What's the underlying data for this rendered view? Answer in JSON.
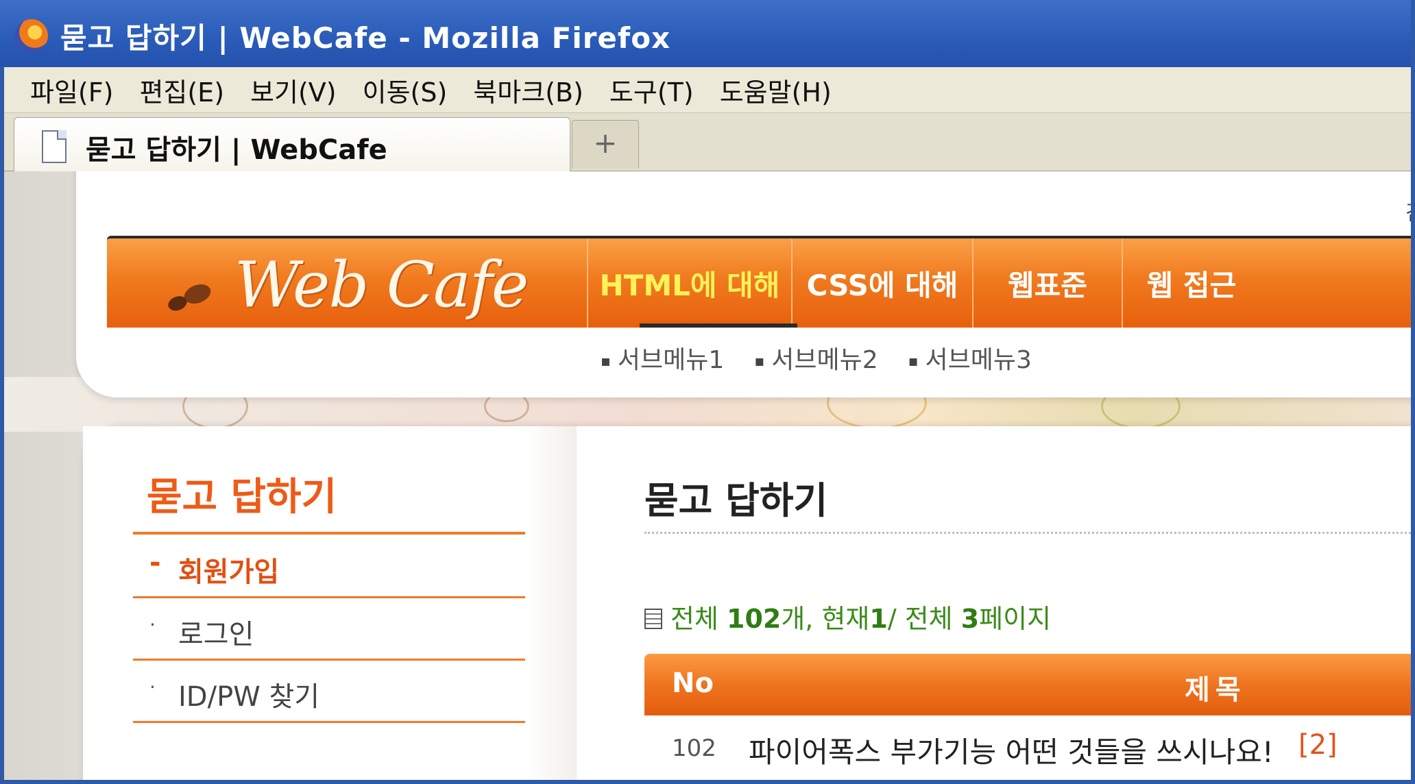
{
  "window": {
    "title": "묻고 답하기 | WebCafe - Mozilla Firefox"
  },
  "menubar": {
    "items": [
      "파일(F)",
      "편집(E)",
      "보기(V)",
      "이동(S)",
      "북마크(B)",
      "도구(T)",
      "도움말(H)"
    ]
  },
  "tabs": {
    "active_label": "묻고 답하기 | WebCafe",
    "new_tab_label": "+"
  },
  "site": {
    "logo_text": "Web Cafe",
    "search_hint": "검",
    "gnb": [
      "HTML에 대해",
      "CSS에 대해",
      "웹표준",
      "웹 접근"
    ],
    "active_gnb_color": "#fff35a",
    "submenu": [
      "서브메뉴1",
      "서브메뉴2",
      "서브메뉴3"
    ]
  },
  "sidebar": {
    "title": "묻고 답하기",
    "items": [
      {
        "bullet": "-",
        "label": "회원가입",
        "active": true
      },
      {
        "bullet": "·",
        "label": "로그인",
        "active": false
      },
      {
        "bullet": "·",
        "label": "ID/PW 찾기",
        "active": false
      }
    ]
  },
  "main": {
    "title": "묻고 답하기",
    "summary": {
      "prefix": "전체 ",
      "total": "102",
      "middle": "개, 현재",
      "current": "1",
      "sep": "/ 전체 ",
      "pages": "3",
      "suffix": "페이지"
    },
    "columns": {
      "no": "No",
      "title": "제목"
    },
    "rows": [
      {
        "no": "102",
        "title": "파이어폭스 부가기능 어떤 것들을 쓰시나요!",
        "comments": "[2]"
      }
    ]
  },
  "colors": {
    "accent_orange": "#f07a1e",
    "summary_green": "#3b8b1a",
    "titlebar_blue": "#2a5bb8"
  }
}
